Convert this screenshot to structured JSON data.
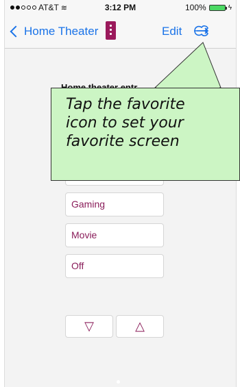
{
  "status_bar": {
    "carrier": "AT&T",
    "time": "3:12 PM",
    "battery": "100%"
  },
  "nav": {
    "back_label": "Home Theater",
    "edit_label": "Edit"
  },
  "main": {
    "section_title": "Home theater entr",
    "activities": [
      {
        "label": ""
      },
      {
        "label": "Gaming"
      },
      {
        "label": "Movie"
      },
      {
        "label": "Off"
      }
    ],
    "volume_down_label": "▽",
    "volume_up_label": "△"
  },
  "tooltip": {
    "line1": "Tap the favorite",
    "line2": "icon to set your",
    "line3": "favorite screen"
  },
  "colors": {
    "accent": "#1a73e8",
    "remote_icon": "#9b1a5c",
    "activity_text": "#8a1d5a",
    "tooltip_bg": "#ccf5c4"
  }
}
